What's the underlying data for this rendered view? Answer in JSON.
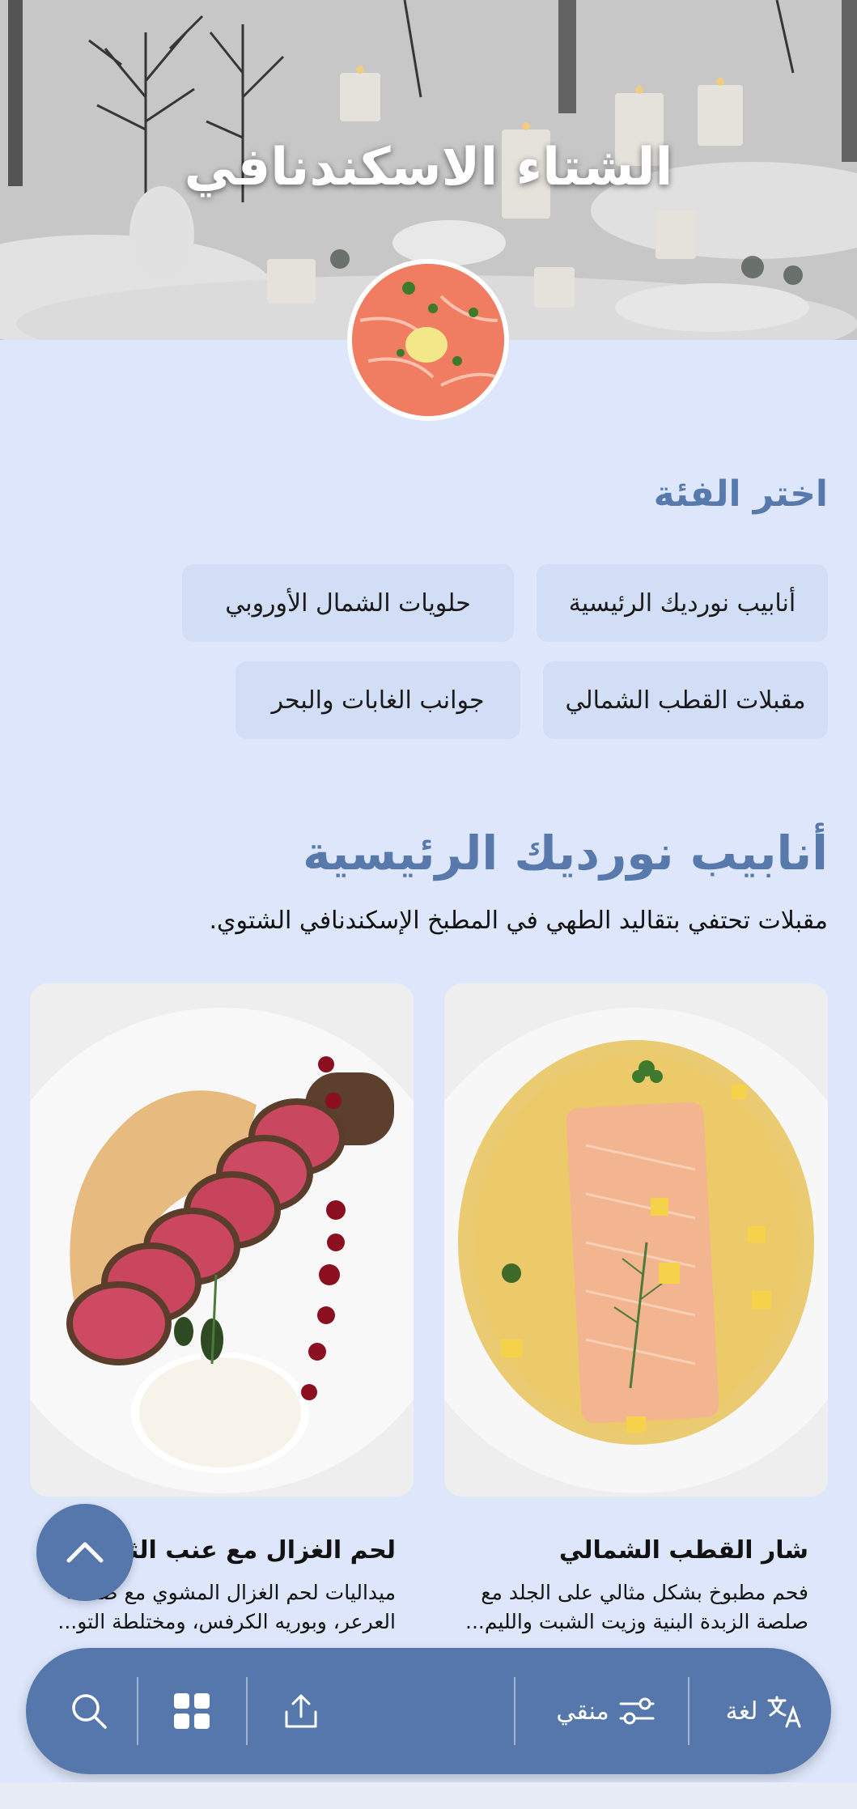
{
  "hero": {
    "title": "الشتاء الاسكندنافي"
  },
  "category_picker": {
    "label": "اختر الفئة",
    "chips": [
      "أنابيب نورديك الرئيسية",
      "حلويات الشمال الأوروبي",
      "مقبلات القطب الشمالي",
      "جوانب الغابات والبحر"
    ]
  },
  "category": {
    "title": "أنابيب نورديك الرئيسية",
    "description": "مقبلات تحتفي بتقاليد الطهي في المطبخ الإسكندنافي الشتوي."
  },
  "dishes": [
    {
      "title": "شار القطب الشمالي",
      "description_line1": "فحم مطبوخ بشكل مثالي على الجلد مع",
      "description_line2": "صلصة الزبدة البنية وزيت الشبت والليم..."
    },
    {
      "title": "لحم الغزال مع عنب الثعلب",
      "description_line1": "ميداليات لحم الغزال المشوي مع صلصة",
      "description_line2": "العرعر، وبوريه الكرفس، ومختلطة التو..."
    }
  ],
  "bottom_bar": {
    "language_label": "لغة",
    "filter_label": "منقي",
    "icons": [
      "translate-icon",
      "filter-sliders-icon",
      "share-icon",
      "grid-icon",
      "search-icon"
    ]
  },
  "colors": {
    "accent": "#5677ac",
    "heading": "#5779ac",
    "background": "#dde6fb",
    "chip": "#d2ddf6"
  }
}
